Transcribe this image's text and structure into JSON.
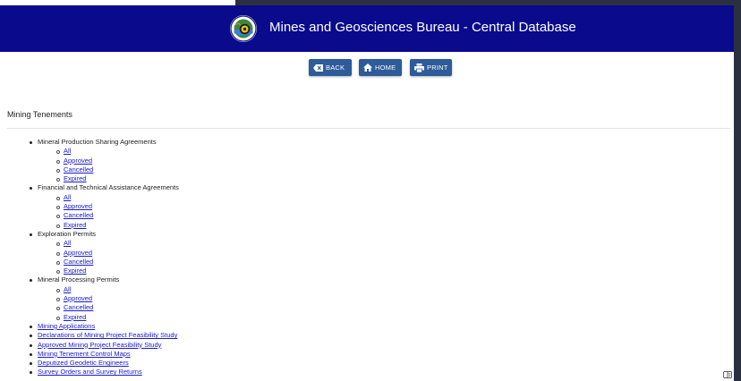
{
  "header": {
    "title": "Mines and Geosciences Bureau - Central Database",
    "logo_icon": "mgb-seal-logo",
    "background": "#0a0a8c"
  },
  "toolbar": {
    "back_label": "BACK",
    "home_label": "HOME",
    "print_label": "PRINT",
    "button_color": "#2e5b9a"
  },
  "section_title": "Mining Tenements",
  "groups": [
    {
      "label": "Mineral Production Sharing Agreements",
      "links": [
        "All",
        "Approved",
        "Cancelled",
        "Expired"
      ]
    },
    {
      "label": "Financial and Technical Assistance Agreements",
      "links": [
        "All",
        "Approved",
        "Cancelled",
        "Expired"
      ]
    },
    {
      "label": "Exploration Permits",
      "links": [
        "All",
        "Approved",
        "Cancelled",
        "Expired"
      ]
    },
    {
      "label": "Mineral Processing Permits",
      "links": [
        "All",
        "Approved",
        "Cancelled",
        "Expired"
      ]
    }
  ],
  "links": [
    "Mining Applications",
    "Declarations of Mining Project Feasibility Study",
    "Approved Mining Project Feasibility Study",
    "Mining Tenement Control Maps",
    "Deputized Geodetic Engineers",
    "Survey Orders and Survey Returns"
  ],
  "colors": {
    "link": "#1a1acc",
    "text": "#222222"
  }
}
